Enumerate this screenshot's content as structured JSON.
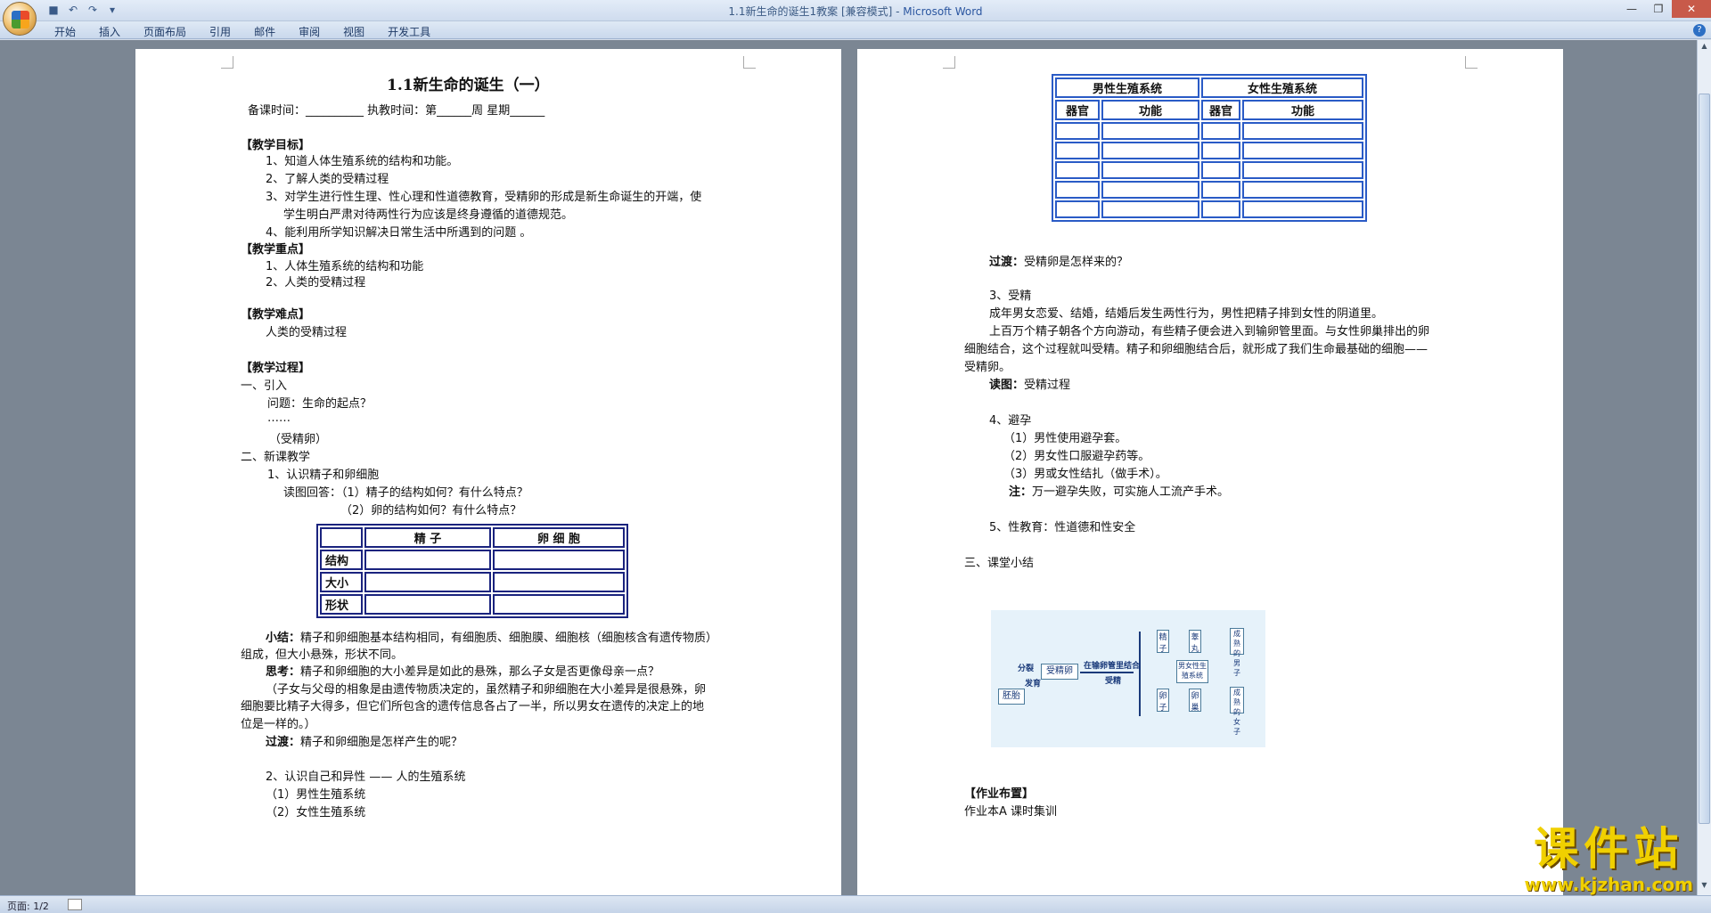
{
  "window": {
    "title": "1.1新生命的诞生1教案 [兼容模式] - ",
    "app": "Microsoft Word",
    "controls": [
      "—",
      "❐",
      "✕"
    ]
  },
  "ribbon": {
    "tabs": [
      "开始",
      "插入",
      "页面布局",
      "引用",
      "邮件",
      "审阅",
      "视图",
      "开发工具"
    ]
  },
  "status": {
    "page": "页面: 1/2"
  },
  "page1": {
    "title": "1.1新生命的诞生（一）",
    "prep_line": "备课时间：__________    执教时间：第______周 星期______",
    "objectives_header": "【教学目标】",
    "objectives": [
      "1、知道人体生殖系统的结构和功能。",
      "2、了解人类的受精过程",
      "3、对学生进行性生理、性心理和性道德教育，受精卵的形成是新生命诞生的开端，使",
      "学生明白严肃对待两性行为应该是终身遵循的道德规范。",
      "4、能利用所学知识解决日常生活中所遇到的问题 。"
    ],
    "key_header": "【教学重点】",
    "key_points": [
      "1、人体生殖系统的结构和功能",
      "2、人类的受精过程"
    ],
    "difficulty_header": "【教学难点】",
    "difficulty": "人类的受精过程",
    "process_header": "【教学过程】",
    "intro": "一、引入",
    "question": "问题：生命的起点？",
    "ellipsis": "……",
    "answer": "（受精卵）",
    "new_lesson": "二、新课教学",
    "item1": "1、认识精子和卵细胞",
    "read_q1": "读图回答：（1）精子的结构如何？有什么特点？",
    "read_q2": "（2）卵的结构如何？有什么特点？",
    "table": {
      "headers": [
        "",
        "精  子",
        "卵 细 胞"
      ],
      "rows": [
        "结构",
        "大小",
        "形状"
      ]
    },
    "summary_label": "小结：",
    "summary": "精子和卵细胞基本结构相同，有细胞质、细胞膜、细胞核（细胞核含有遗传物质）",
    "summary2": "组成，但大小悬殊，形状不同。",
    "think_label": "思考：",
    "think": "精子和卵细胞的大小差异是如此的悬殊，那么子女是否更像母亲一点？",
    "explain1": "（子女与父母的相象是由遗传物质决定的，虽然精子和卵细胞在大小差异是很悬殊，卵",
    "explain2": "细胞要比精子大得多，但它们所包含的遗传信息各占了一半，所以男女在遗传的决定上的地",
    "explain3": "位是一样的。）",
    "transition_label": "过渡：",
    "transition": "精子和卵细胞是怎样产生的呢？",
    "item2": "2、认识自己和异性 —— 人的生殖系统",
    "male": "（1）男性生殖系统",
    "female": "（2）女性生殖系统"
  },
  "page2": {
    "table": {
      "group_headers": [
        "男性生殖系统",
        "女性生殖系统"
      ],
      "sub_headers": [
        "器官",
        "功能",
        "器官",
        "功能"
      ],
      "empty_rows": 5
    },
    "transition_label": "过渡：",
    "transition": "受精卵是怎样来的？",
    "item3": "3、受精",
    "p1": "成年男女恋爱、结婚，结婚后发生两性行为，男性把精子排到女性的阴道里。",
    "p2": "上百万个精子朝各个方向游动，有些精子便会进入到输卵管里面。与女性卵巢排出的卵",
    "p3": "细胞结合，这个过程就叫受精。精子和卵细胞结合后，就形成了我们生命最基础的细胞——",
    "p4": "受精卵。",
    "read_label": "读图：",
    "read": "受精过程",
    "item4": "4、避孕",
    "c1": "（1）男性使用避孕套。",
    "c2": "（2）男女性口服避孕药等。",
    "c3": "（3）男或女性结扎（做手术）。",
    "note_label": "注：",
    "note": "万一避孕失败，可实施人工流产手术。",
    "item5": "5、性教育：性道德和性安全",
    "summary": "三、课堂小结",
    "diagram": {
      "embryo": "胚胎",
      "zygote": "受精卵",
      "division": "分裂",
      "development": "发育",
      "oviduct": "在输卵管里结合",
      "fertilize": "受精",
      "sperm": "精子",
      "testis": "睾丸",
      "egg": "卵子",
      "ovary": "卵巢",
      "system": "男女性生殖系统",
      "mature_male": "成熟的男子",
      "mature_female": "成熟的女子"
    },
    "homework_header": "【作业布置】",
    "homework": "作业本A   课时集训"
  },
  "watermark": {
    "cn": "课件站",
    "url": "www.kjzhan.com"
  },
  "colors": {
    "table_border": "#1a237e",
    "table2_border": "#2a5bc6",
    "watermark": "#f0d000"
  }
}
